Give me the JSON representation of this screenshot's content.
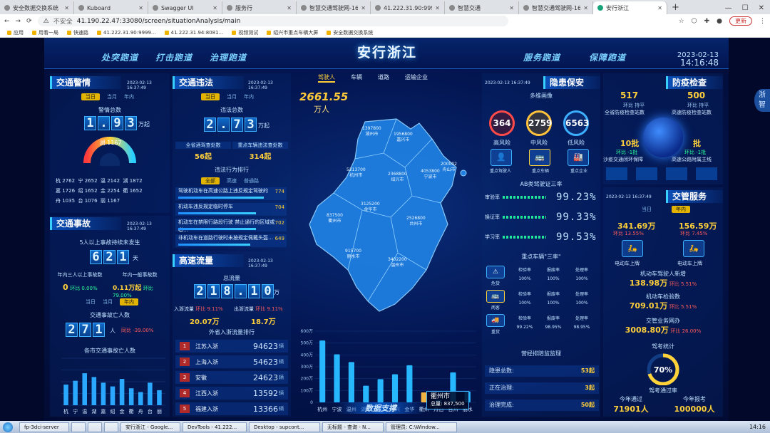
{
  "browser": {
    "tabs": [
      {
        "label": "安全数据交换系统"
      },
      {
        "label": "Kuboard"
      },
      {
        "label": "Swagger UI"
      },
      {
        "label": "服务行"
      },
      {
        "label": "智慧交通驾驶网-1675"
      },
      {
        "label": "41.222.31.90:9999/p"
      },
      {
        "label": "智慧交通"
      },
      {
        "label": "智慧交通驾驶网-1675"
      },
      {
        "label": "安行浙江"
      }
    ],
    "new_tab": "+",
    "url_prefix": "不安全",
    "url": "41.190.22.47:33080/screen/situationAnalysis/main",
    "update_label": "更新",
    "bookmarks": [
      "应用",
      "用看一局",
      "快速路",
      "41.222.31.90:9999...",
      "41.222.31.94:8081...",
      "视频测试",
      "绍兴市重点车辆大屏",
      "安全数据交换系统"
    ]
  },
  "header": {
    "title": "安行浙江",
    "nav_left": [
      "处突跑道",
      "打击跑道",
      "治理跑道"
    ],
    "nav_right": [
      "服务跑道",
      "保障跑道"
    ],
    "date": "2023-02-13",
    "time": "14:16:48"
  },
  "traffic_alarm": {
    "title": "交通警情",
    "date": "2023-02-13 16:37:49",
    "periods": [
      "当日",
      "当月",
      "年内"
    ],
    "total_label": "警情总数",
    "digits": [
      "1",
      ".",
      "9",
      "3"
    ],
    "unit": "万起",
    "gauge_value": "湖:1167",
    "cities": [
      "杭 2762",
      "宁 2652",
      "温 2142",
      "湖 1872",
      "嘉 1726",
      "绍 1652",
      "金 2254",
      "衢 1652",
      "舟 1035",
      "台 1076",
      "丽 1167"
    ]
  },
  "traffic_violation": {
    "title": "交通违法",
    "date": "2023-02-13 16:37:49",
    "periods": [
      "当日",
      "当月",
      "年内"
    ],
    "total_label": "违法总数",
    "digits": [
      "2",
      ".",
      "7",
      "3"
    ],
    "unit": "万起",
    "drunk_label": "全省酒驾查处数",
    "drunk_value": "56起",
    "key_label": "重点车辆违法查处数",
    "key_value": "314起",
    "rank_title": "违法行为排行",
    "rank_tabs": [
      "全部",
      "高速",
      "普通路"
    ],
    "ranks": [
      {
        "label": "驾驶机动车在高速公路上违反规定驾驶的",
        "value": "774"
      },
      {
        "label": "机动车违反规定临时停车",
        "value": "704"
      },
      {
        "label": "机动车在禁限行路段行驶 禁止通行的区域或者…",
        "value": "702"
      },
      {
        "label": "非机动车在道路行驶时未按规定佩戴头盔…",
        "value": "649"
      }
    ]
  },
  "traffic_accident": {
    "title": "交通事故",
    "date": "2023-02-13 16:37:49",
    "sub_label": "5人以上事故持续未发生",
    "digits": [
      "6",
      "2",
      "1"
    ],
    "unit": "天",
    "big_label": "年内三人以上事故数",
    "big_value": "0",
    "big_rate": "环比 0.00%",
    "normal_label": "年内一般事故数",
    "normal_value": "0.11万起",
    "normal_rate": "环比 79.00%",
    "periods": [
      "当日",
      "当月",
      "年内"
    ],
    "death_label": "交通事故亡人数",
    "death_digits": [
      "2",
      "7",
      "1"
    ],
    "death_unit": "人",
    "death_rate": "同比 -39.00%",
    "chart_title": "各市交通事故亡人数"
  },
  "highway_flow": {
    "title": "高速流量",
    "date": "2023-02-13 16:37:49",
    "total_label": "总流量",
    "digits": [
      "2",
      "1",
      "8",
      ".",
      "1",
      "0"
    ],
    "unit": "万",
    "in_label": "入浙流量",
    "in_rate": "环比 9.11%",
    "in_value": "20.07万",
    "out_label": "出浙流量",
    "out_rate": "环比 9.11%",
    "out_value": "18.7万",
    "rank_title": "外省入浙流量排行",
    "ranks": [
      {
        "no": "1",
        "label": "江苏入浙",
        "value": "94623",
        "unit": "辆"
      },
      {
        "no": "2",
        "label": "上海入浙",
        "value": "54623",
        "unit": "辆"
      },
      {
        "no": "3",
        "label": "安徽",
        "value": "24623",
        "unit": "辆"
      },
      {
        "no": "4",
        "label": "江西入浙",
        "value": "13592",
        "unit": "辆"
      },
      {
        "no": "5",
        "label": "福建入浙",
        "value": "13366",
        "unit": "辆"
      }
    ]
  },
  "center": {
    "tabs": [
      "驾驶人",
      "车辆",
      "道路",
      "运输企业"
    ],
    "total": "2661.55",
    "total_unit": "万人",
    "map_cities": [
      {
        "name": "湖州市",
        "value": "1397800"
      },
      {
        "name": "嘉兴市",
        "value": "1956800"
      },
      {
        "name": "杭州市",
        "value": "5213700"
      },
      {
        "name": "绍兴市",
        "value": "2368800"
      },
      {
        "name": "宁波市",
        "value": "4053800"
      },
      {
        "name": "舟山市",
        "value": "200002"
      },
      {
        "name": "金华市",
        "value": "3125200"
      },
      {
        "name": "衢州市",
        "value": "837500"
      },
      {
        "name": "台州市",
        "value": "2526800"
      },
      {
        "name": "丽水市",
        "value": "915700"
      },
      {
        "name": "温州市",
        "value": "3402200"
      }
    ],
    "bottom_label": "数据支撑",
    "tooltip_city": "衢州市",
    "tooltip_total": "总量: 837,500"
  },
  "chart_data": [
    {
      "type": "bar",
      "title": "各市交通事故亡人数",
      "categories": [
        "杭",
        "宁",
        "温",
        "湖",
        "嘉",
        "绍",
        "金",
        "衢",
        "舟",
        "台",
        "丽"
      ],
      "values": [
        22,
        26,
        34,
        30,
        24,
        20,
        28,
        18,
        14,
        24,
        16
      ],
      "ylim": [
        0,
        50
      ]
    },
    {
      "type": "bar",
      "categories": [
        "杭州",
        "宁波",
        "温州",
        "湖州",
        "嘉兴",
        "绍兴",
        "金华",
        "衢州",
        "舟山",
        "台州",
        "丽水"
      ],
      "values": [
        521,
        405,
        340,
        140,
        196,
        237,
        313,
        84,
        20,
        253,
        92
      ],
      "yticks": [
        "600万",
        "500万",
        "400万",
        "300万",
        "200万",
        "100万",
        "0"
      ],
      "ylim": [
        0,
        600
      ]
    }
  ],
  "risk": {
    "title": "隐患保安",
    "date": "2023-02-13 16:37:49",
    "sub_title": "多维画像",
    "high": "364",
    "high_label": "高风险",
    "mid": "2759",
    "mid_label": "中风险",
    "low": "6563",
    "low_label": "低风险",
    "icons": [
      "重点驾驶人",
      "重点车辆",
      "重点企业"
    ],
    "ab_title": "AB类驾驶证三率",
    "rates": [
      {
        "label": "审验率",
        "value": "99.23%"
      },
      {
        "label": "换证率",
        "value": "99.33%"
      },
      {
        "label": "学习率",
        "value": "99.53%"
      }
    ],
    "three_title": "重点车辆\"三率\"",
    "three_rows": [
      {
        "type": "危货",
        "cols": [
          "检验率",
          "报废率",
          "处理率"
        ],
        "vals": [
          "100%",
          "100%",
          "100%"
        ]
      },
      {
        "type": "两客",
        "cols": [
          "检验率",
          "报废率",
          "处理率"
        ],
        "vals": [
          "100%",
          "100%",
          "100%"
        ]
      },
      {
        "type": "重货",
        "cols": [
          "检验率",
          "报废率",
          "处理率"
        ],
        "vals": [
          "99.22%",
          "98.95%",
          "98.95%"
        ]
      }
    ],
    "vendor_title": "营经排陪监监理",
    "vendor": [
      {
        "label": "隐患总数:",
        "value": "53起"
      },
      {
        "label": "正在治理:",
        "value": "3起"
      },
      {
        "label": "治理完成:",
        "value": "50起"
      }
    ]
  },
  "prevention": {
    "title": "防疫检查",
    "a_value": "517",
    "a_rate": "环比 持平",
    "a_label": "全省防疫检查站数",
    "b_value": "500",
    "b_rate": "环比 持平",
    "b_label": "高速防疫检查站数",
    "c_value": "10批",
    "c_rate": "环比 -1批",
    "c_label": "沙疫交通闭环保障",
    "d_value": "批",
    "d_rate": "环比 -1批",
    "d_label": "高速公路附属主线"
  },
  "service": {
    "title": "交管服务",
    "date": "2023-02-13 16:37:49",
    "periods": [
      "当日",
      "年内"
    ],
    "a_value": "341.69万",
    "a_rate": "环比 13.55%",
    "a_label": "电动车上牌",
    "b_value": "156.59万",
    "b_rate": "环比 7.45%",
    "b_label": "电动车上牌",
    "c_label": "机动车驾驶人新增",
    "c_value": "138.98万",
    "c_rate": "环比 5.51%",
    "d_label": "机动车检验数",
    "d_value": "709.01万",
    "d_rate": "环比 5.51%",
    "e_label": "交管业务网办",
    "e_value": "3008.80万",
    "e_rate": "环比 26.00%",
    "exam_title": "驾考统计",
    "exam_rate": "70%",
    "exam_rate_label": "驾考通过率",
    "pass_label": "今年通过",
    "pass_value": "71901人",
    "total_label": "今年报考",
    "total_value": "100000人"
  },
  "taskbar": {
    "items": [
      "fp-3dci-server",
      "",
      "",
      "",
      "安行浙江 - Google...",
      "DevTools - 41.222...",
      "Desktop - supcont...",
      "无标题 - 查询 - N...",
      "管理员: C:\\Window..."
    ],
    "time": "14:16"
  }
}
